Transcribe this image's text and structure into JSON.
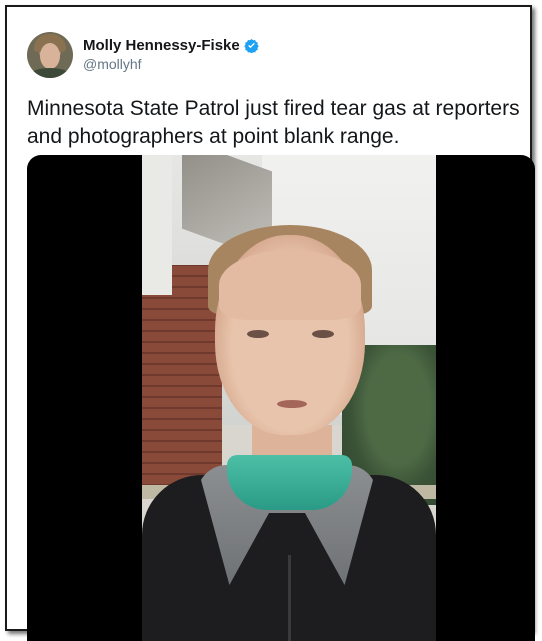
{
  "tweet": {
    "author_name": "Molly Hennessy-Fiske",
    "handle": "@mollyhf",
    "verified": true,
    "text": "Minnesota State Patrol just fired tear gas at reporters and photographers at point blank range."
  },
  "icons": {
    "verified": "verified-badge-icon",
    "avatar": "profile-avatar"
  },
  "colors": {
    "text": "#14171a",
    "handle": "#657786",
    "verified_blue": "#1da1f2",
    "video_background": "#000000",
    "mask": "#3aae98"
  }
}
